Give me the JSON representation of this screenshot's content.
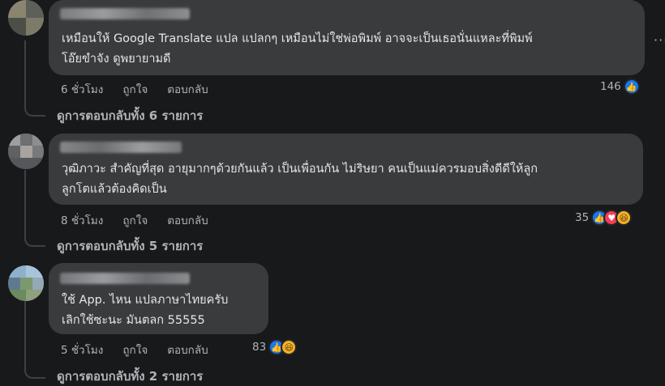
{
  "comments": [
    {
      "text": "เหมือนให้ Google Translate แปล แปลกๆ เหมือนไม่ใช่พ่อพิมพ์ อาจจะเป็นเธอนั่นแหละที่พิมพ์\nโอ๊ยขำจัง ดูพยายามดี",
      "time": "6 ชั่วโมง",
      "like_label": "ถูกใจ",
      "reply_label": "ตอบกลับ",
      "reaction_count": "146",
      "reactions": [
        "like-icon"
      ],
      "replies_label": "ดูการตอบกลับทั้ง 6 รายการ"
    },
    {
      "text": "วุฒิภาวะ สำคัญที่สุด อายุมากๆด้วยกันแล้ว เป็นเพื่อนกัน ไม่ริษยา คนเป็นแม่ควรมอบสิ่งดีดีให้ลูก\nลูกโตแล้วต้องคิดเป็น",
      "time": "8 ชั่วโมง",
      "like_label": "ถูกใจ",
      "reply_label": "ตอบกลับ",
      "reaction_count": "35",
      "reactions": [
        "like-icon",
        "love-icon",
        "haha-icon"
      ],
      "replies_label": "ดูการตอบกลับทั้ง 5 รายการ"
    },
    {
      "text": "ใช้ App. ไหน แปลภาษาไทยครับ\nเลิกใช้ซะนะ มันตลก 55555",
      "time": "5 ชั่วโมง",
      "like_label": "ถูกใจ",
      "reply_label": "ตอบกลับ",
      "reaction_count": "83",
      "reactions": [
        "like-icon",
        "haha-icon"
      ],
      "replies_label": "ดูการตอบกลับทั้ง 2 รายการ"
    }
  ],
  "more_icon": "···",
  "colors": {
    "background": "#18191a",
    "bubble": "#3a3b3c",
    "text": "#e4e6eb",
    "secondary": "#b0b3b8",
    "like": "#1877f2",
    "love": "#f33e58",
    "haha": "#f7b125"
  }
}
